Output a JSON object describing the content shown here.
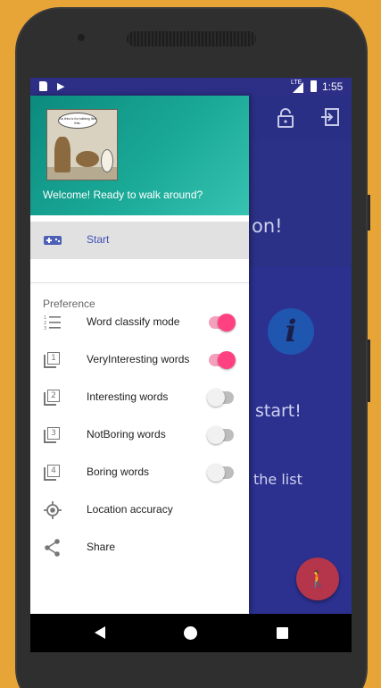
{
  "statusbar": {
    "network": "LTE",
    "time": "1:55"
  },
  "background_app": {
    "title_fragment": "on!",
    "start_fragment": "start!",
    "list_fragment": "the list"
  },
  "drawer": {
    "header": {
      "cartoon_caption": "So this is for talking like this.",
      "welcome": "Welcome! Ready to walk around?"
    },
    "start_item": {
      "label": "Start",
      "icon": "gamepad-icon"
    },
    "section_title": "Preference",
    "items": [
      {
        "label": "Word classify mode",
        "icon": "numbered-list-icon",
        "switch": "on"
      },
      {
        "label": "VeryInteresting words",
        "icon": "filter-1-icon",
        "number": "1",
        "switch": "on"
      },
      {
        "label": "Interesting words",
        "icon": "filter-2-icon",
        "number": "2",
        "switch": "off"
      },
      {
        "label": "NotBoring words",
        "icon": "filter-3-icon",
        "number": "3",
        "switch": "off"
      },
      {
        "label": "Boring words",
        "icon": "filter-4-icon",
        "number": "4",
        "switch": "off"
      },
      {
        "label": "Location accuracy",
        "icon": "gps-icon"
      },
      {
        "label": "Share",
        "icon": "share-icon"
      }
    ]
  },
  "colors": {
    "accent": "#ff4081",
    "primary_dark": "#2c3190",
    "header_teal": "#1aa996",
    "fab": "#b5364a"
  }
}
